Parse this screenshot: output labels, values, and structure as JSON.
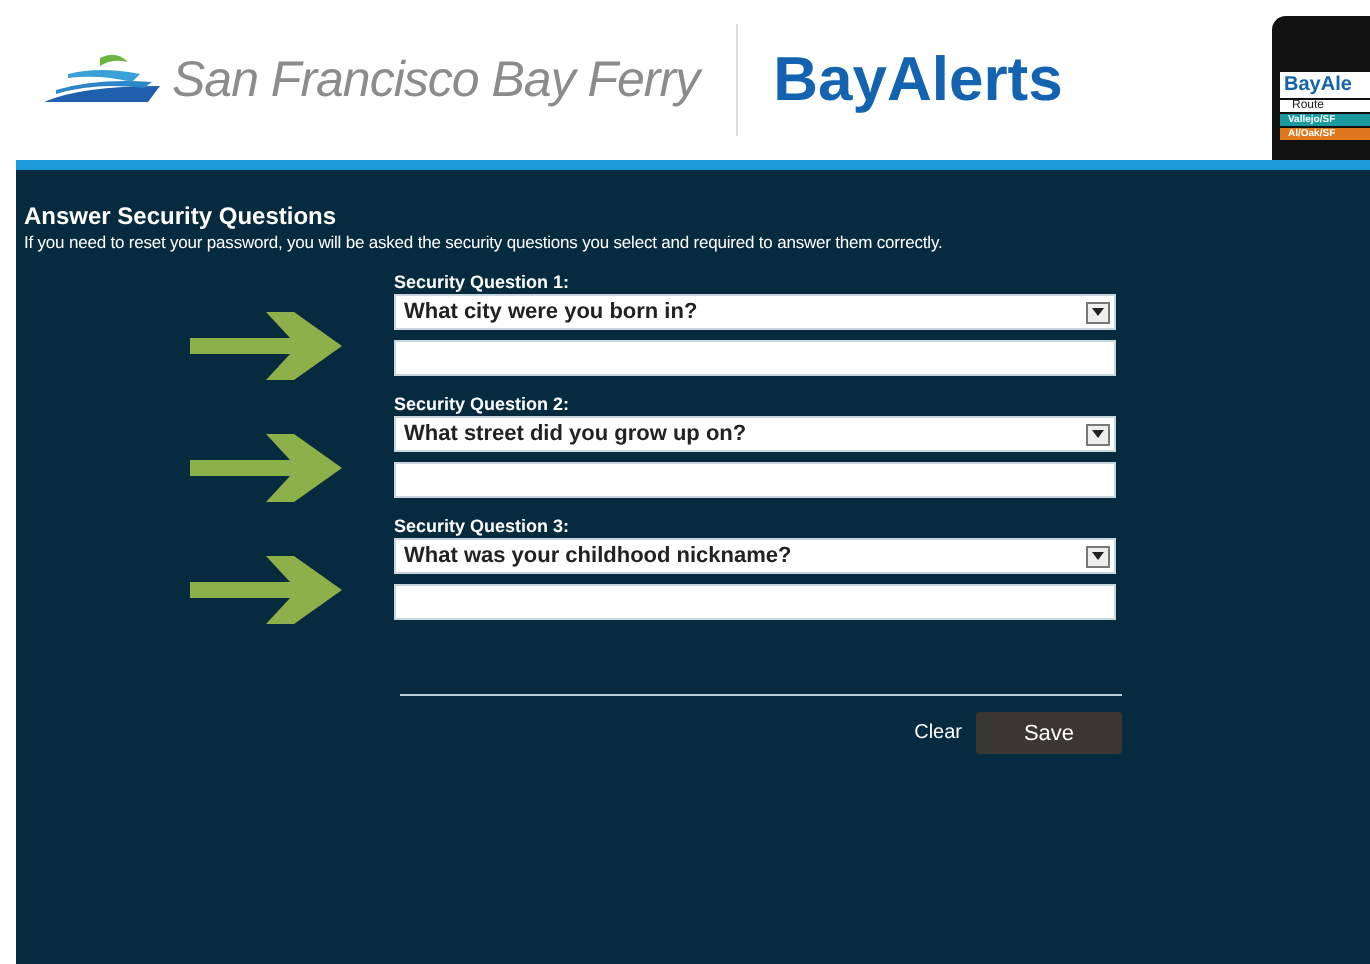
{
  "header": {
    "brand": "San Francisco Bay Ferry",
    "product": "BayAlerts",
    "phone": {
      "title": "BayAle",
      "label": "Route",
      "routes": [
        {
          "name": "Vallejo/SF",
          "color": "#1a9aa0"
        },
        {
          "name": "Al/Oak/SF",
          "color": "#e0781e"
        }
      ]
    }
  },
  "form": {
    "title": "Answer Security Questions",
    "description": "If you need to reset your password, you will be asked the security questions you select and required to answer them correctly.",
    "questions": [
      {
        "label": "Security Question 1:",
        "value": "What city were you born in?"
      },
      {
        "label": "Security Question 2:",
        "value": "What street did you grow up on?"
      },
      {
        "label": "Security Question 3:",
        "value": "What was your childhood nickname?"
      }
    ],
    "buttons": [
      {
        "kind": "link",
        "label": "Clear"
      },
      {
        "kind": "primary",
        "label": "Save"
      }
    ]
  }
}
